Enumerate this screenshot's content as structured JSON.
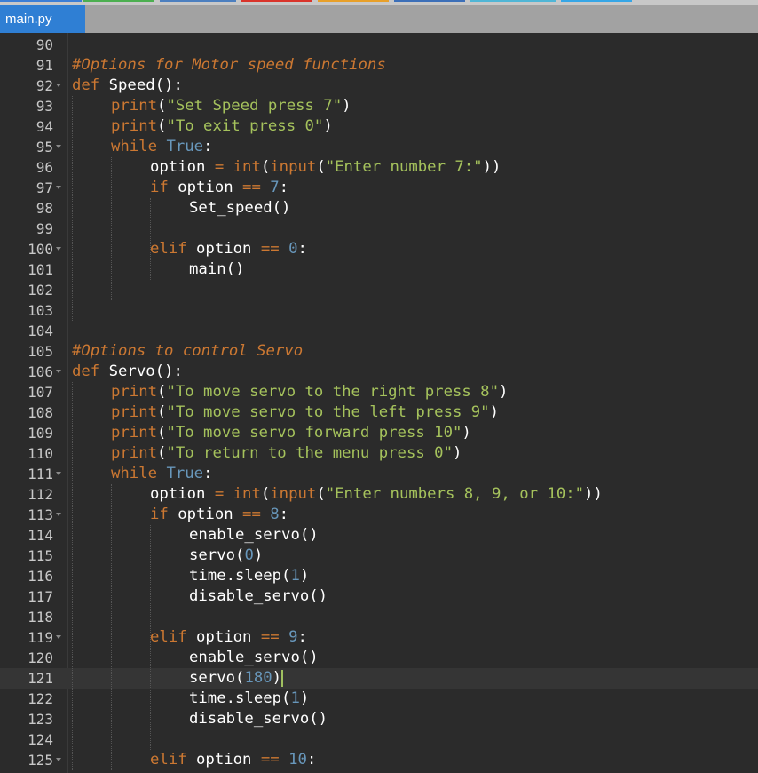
{
  "window": {
    "color_strips": [
      "#3b7ed6",
      "#4caf50",
      "#4c7fbf",
      "#d9342b",
      "#e8a02a",
      "#3c6fb8",
      "#50b6d6",
      "#36a6e6"
    ]
  },
  "tab": {
    "label": "main.py"
  },
  "colors": {
    "background": "#2b2b2b",
    "active_line": "#353535",
    "keyword": "#cc7832",
    "string": "#a5c25c",
    "number": "#6897bb",
    "comment": "#cc7832",
    "builtin": "#cc7832",
    "def_name": "#ffffff",
    "default": "#ffffff",
    "line_number": "#c8c8c8"
  },
  "editor": {
    "active_line": "121",
    "lines": [
      {
        "n": "90",
        "fold": false,
        "indent": 0,
        "tokens": []
      },
      {
        "n": "91",
        "fold": false,
        "indent": 0,
        "tokens": [
          {
            "t": "#Options for Motor speed functions",
            "c": "cm"
          }
        ]
      },
      {
        "n": "92",
        "fold": true,
        "indent": 0,
        "tokens": [
          {
            "t": "def",
            "c": "kw"
          },
          {
            "t": " Speed():",
            "c": "df"
          }
        ]
      },
      {
        "n": "93",
        "fold": false,
        "indent": 1,
        "tokens": [
          {
            "t": "print",
            "c": "kw"
          },
          {
            "t": "(",
            "c": "df"
          },
          {
            "t": "\"Set Speed press 7\"",
            "c": "st"
          },
          {
            "t": ")",
            "c": "df"
          }
        ]
      },
      {
        "n": "94",
        "fold": false,
        "indent": 1,
        "tokens": [
          {
            "t": "print",
            "c": "kw"
          },
          {
            "t": "(",
            "c": "df"
          },
          {
            "t": "\"To exit press 0\"",
            "c": "st"
          },
          {
            "t": ")",
            "c": "df"
          }
        ]
      },
      {
        "n": "95",
        "fold": true,
        "indent": 1,
        "tokens": [
          {
            "t": "while",
            "c": "kw"
          },
          {
            "t": " ",
            "c": "df"
          },
          {
            "t": "True",
            "c": "nu"
          },
          {
            "t": ":",
            "c": "df"
          }
        ]
      },
      {
        "n": "96",
        "fold": false,
        "indent": 2,
        "tokens": [
          {
            "t": "option ",
            "c": "df"
          },
          {
            "t": "=",
            "c": "kw"
          },
          {
            "t": " ",
            "c": "df"
          },
          {
            "t": "int",
            "c": "bi"
          },
          {
            "t": "(",
            "c": "df"
          },
          {
            "t": "input",
            "c": "bi"
          },
          {
            "t": "(",
            "c": "df"
          },
          {
            "t": "\"Enter number 7:\"",
            "c": "st"
          },
          {
            "t": "))",
            "c": "df"
          }
        ]
      },
      {
        "n": "97",
        "fold": true,
        "indent": 2,
        "tokens": [
          {
            "t": "if",
            "c": "kw"
          },
          {
            "t": " option ",
            "c": "df"
          },
          {
            "t": "==",
            "c": "kw"
          },
          {
            "t": " ",
            "c": "df"
          },
          {
            "t": "7",
            "c": "nu"
          },
          {
            "t": ":",
            "c": "df"
          }
        ]
      },
      {
        "n": "98",
        "fold": false,
        "indent": 3,
        "tokens": [
          {
            "t": "Set_speed()",
            "c": "df"
          }
        ]
      },
      {
        "n": "99",
        "fold": false,
        "indent": 0,
        "tokens": []
      },
      {
        "n": "100",
        "fold": true,
        "indent": 2,
        "tokens": [
          {
            "t": "elif",
            "c": "kw"
          },
          {
            "t": " option ",
            "c": "df"
          },
          {
            "t": "==",
            "c": "kw"
          },
          {
            "t": " ",
            "c": "df"
          },
          {
            "t": "0",
            "c": "nu"
          },
          {
            "t": ":",
            "c": "df"
          }
        ]
      },
      {
        "n": "101",
        "fold": false,
        "indent": 3,
        "tokens": [
          {
            "t": "main()",
            "c": "df"
          }
        ]
      },
      {
        "n": "102",
        "fold": false,
        "indent": 0,
        "tokens": []
      },
      {
        "n": "103",
        "fold": false,
        "indent": 0,
        "tokens": []
      },
      {
        "n": "104",
        "fold": false,
        "indent": 0,
        "tokens": []
      },
      {
        "n": "105",
        "fold": false,
        "indent": 0,
        "tokens": [
          {
            "t": "#Options to control Servo",
            "c": "cm"
          }
        ]
      },
      {
        "n": "106",
        "fold": true,
        "indent": 0,
        "tokens": [
          {
            "t": "def",
            "c": "kw"
          },
          {
            "t": " Servo():",
            "c": "df"
          }
        ]
      },
      {
        "n": "107",
        "fold": false,
        "indent": 1,
        "tokens": [
          {
            "t": "print",
            "c": "kw"
          },
          {
            "t": "(",
            "c": "df"
          },
          {
            "t": "\"To move servo to the right press 8\"",
            "c": "st"
          },
          {
            "t": ")",
            "c": "df"
          }
        ]
      },
      {
        "n": "108",
        "fold": false,
        "indent": 1,
        "tokens": [
          {
            "t": "print",
            "c": "kw"
          },
          {
            "t": "(",
            "c": "df"
          },
          {
            "t": "\"To move servo to the left press 9\"",
            "c": "st"
          },
          {
            "t": ")",
            "c": "df"
          }
        ]
      },
      {
        "n": "109",
        "fold": false,
        "indent": 1,
        "tokens": [
          {
            "t": "print",
            "c": "kw"
          },
          {
            "t": "(",
            "c": "df"
          },
          {
            "t": "\"To move servo forward press 10\"",
            "c": "st"
          },
          {
            "t": ")",
            "c": "df"
          }
        ]
      },
      {
        "n": "110",
        "fold": false,
        "indent": 1,
        "tokens": [
          {
            "t": "print",
            "c": "kw"
          },
          {
            "t": "(",
            "c": "df"
          },
          {
            "t": "\"To return to the menu press 0\"",
            "c": "st"
          },
          {
            "t": ")",
            "c": "df"
          }
        ]
      },
      {
        "n": "111",
        "fold": true,
        "indent": 1,
        "tokens": [
          {
            "t": "while",
            "c": "kw"
          },
          {
            "t": " ",
            "c": "df"
          },
          {
            "t": "True",
            "c": "nu"
          },
          {
            "t": ":",
            "c": "df"
          }
        ]
      },
      {
        "n": "112",
        "fold": false,
        "indent": 2,
        "tokens": [
          {
            "t": "option ",
            "c": "df"
          },
          {
            "t": "=",
            "c": "kw"
          },
          {
            "t": " ",
            "c": "df"
          },
          {
            "t": "int",
            "c": "bi"
          },
          {
            "t": "(",
            "c": "df"
          },
          {
            "t": "input",
            "c": "bi"
          },
          {
            "t": "(",
            "c": "df"
          },
          {
            "t": "\"Enter numbers 8, 9, or 10:\"",
            "c": "st"
          },
          {
            "t": "))",
            "c": "df"
          }
        ]
      },
      {
        "n": "113",
        "fold": true,
        "indent": 2,
        "tokens": [
          {
            "t": "if",
            "c": "kw"
          },
          {
            "t": " option ",
            "c": "df"
          },
          {
            "t": "==",
            "c": "kw"
          },
          {
            "t": " ",
            "c": "df"
          },
          {
            "t": "8",
            "c": "nu"
          },
          {
            "t": ":",
            "c": "df"
          }
        ]
      },
      {
        "n": "114",
        "fold": false,
        "indent": 3,
        "tokens": [
          {
            "t": "enable_servo()",
            "c": "df"
          }
        ]
      },
      {
        "n": "115",
        "fold": false,
        "indent": 3,
        "tokens": [
          {
            "t": "servo(",
            "c": "df"
          },
          {
            "t": "0",
            "c": "nu"
          },
          {
            "t": ")",
            "c": "df"
          }
        ]
      },
      {
        "n": "116",
        "fold": false,
        "indent": 3,
        "tokens": [
          {
            "t": "time.sleep(",
            "c": "df"
          },
          {
            "t": "1",
            "c": "nu"
          },
          {
            "t": ")",
            "c": "df"
          }
        ]
      },
      {
        "n": "117",
        "fold": false,
        "indent": 3,
        "tokens": [
          {
            "t": "disable_servo()",
            "c": "df"
          }
        ]
      },
      {
        "n": "118",
        "fold": false,
        "indent": 0,
        "tokens": []
      },
      {
        "n": "119",
        "fold": true,
        "indent": 2,
        "tokens": [
          {
            "t": "elif",
            "c": "kw"
          },
          {
            "t": " option ",
            "c": "df"
          },
          {
            "t": "==",
            "c": "kw"
          },
          {
            "t": " ",
            "c": "df"
          },
          {
            "t": "9",
            "c": "nu"
          },
          {
            "t": ":",
            "c": "df"
          }
        ]
      },
      {
        "n": "120",
        "fold": false,
        "indent": 3,
        "tokens": [
          {
            "t": "enable_servo()",
            "c": "df"
          }
        ]
      },
      {
        "n": "121",
        "fold": false,
        "indent": 3,
        "cursor": true,
        "tokens": [
          {
            "t": "servo(",
            "c": "df"
          },
          {
            "t": "180",
            "c": "nu"
          },
          {
            "t": ")",
            "c": "df"
          }
        ]
      },
      {
        "n": "122",
        "fold": false,
        "indent": 3,
        "tokens": [
          {
            "t": "time.sleep(",
            "c": "df"
          },
          {
            "t": "1",
            "c": "nu"
          },
          {
            "t": ")",
            "c": "df"
          }
        ]
      },
      {
        "n": "123",
        "fold": false,
        "indent": 3,
        "tokens": [
          {
            "t": "disable_servo()",
            "c": "df"
          }
        ]
      },
      {
        "n": "124",
        "fold": false,
        "indent": 0,
        "tokens": []
      },
      {
        "n": "125",
        "fold": true,
        "indent": 2,
        "tokens": [
          {
            "t": "elif",
            "c": "kw"
          },
          {
            "t": " option ",
            "c": "df"
          },
          {
            "t": "==",
            "c": "kw"
          },
          {
            "t": " ",
            "c": "df"
          },
          {
            "t": "10",
            "c": "nu"
          },
          {
            "t": ":",
            "c": "df"
          }
        ]
      }
    ]
  }
}
